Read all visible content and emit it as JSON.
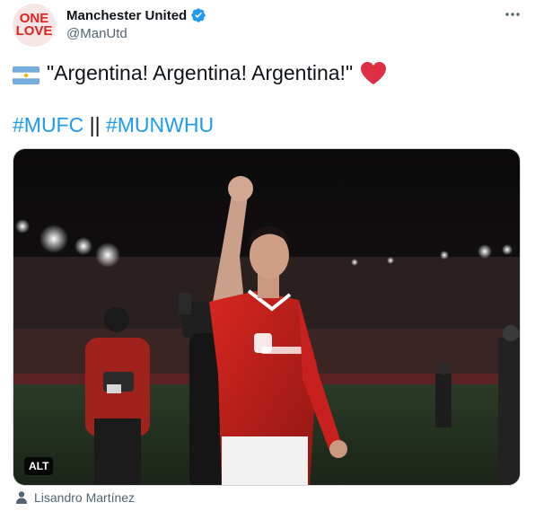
{
  "account": {
    "display_name": "Manchester United",
    "handle": "@ManUtd",
    "avatar_text": [
      "ONE",
      "LOVE"
    ],
    "verified": true
  },
  "tweet": {
    "text": "\"Argentina! Argentina! Argentina!\"",
    "leading_emoji": "argentina-flag",
    "trailing_emoji": "red-heart",
    "hashtag1": "#MUFC",
    "separator": "||",
    "hashtag2": "#MUNWHU"
  },
  "media": {
    "alt_label": "ALT",
    "tagged_person": "Lisandro Martínez"
  },
  "colors": {
    "link": "#1d9bf0",
    "verified": "#1d9bf0",
    "secondary_text": "#536471",
    "kit_red": "#c8201f"
  },
  "icons": [
    "more-icon",
    "verified-badge-icon",
    "argentina-flag-icon",
    "red-heart-icon",
    "person-icon"
  ]
}
